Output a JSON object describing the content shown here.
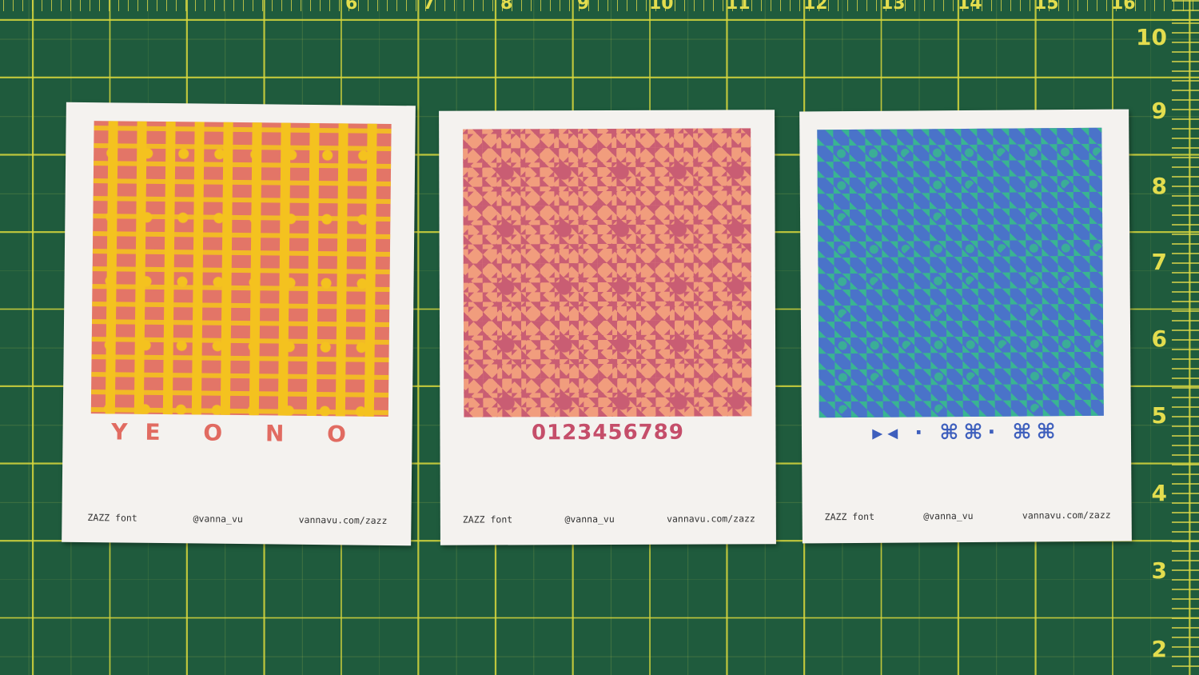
{
  "ruler": {
    "top_numbers": [
      "6",
      "7",
      "8",
      "9",
      "10",
      "11",
      "12",
      "13",
      "14",
      "15",
      "16"
    ],
    "side_numbers": [
      "10",
      "9",
      "8",
      "7",
      "6",
      "5",
      "4",
      "3",
      "2"
    ]
  },
  "cards": [
    {
      "glyphs": "YE O N O",
      "footer": {
        "name": "ZAZZ font",
        "handle": "@vanna_vu",
        "url": "vannavu.com/zazz"
      }
    },
    {
      "glyphs": "0123456789",
      "footer": {
        "name": "ZAZZ font",
        "handle": "@vanna_vu",
        "url": "vannavu.com/zazz"
      }
    },
    {
      "glyphs": "▸◂ · ⌘⌘· ⌘⌘",
      "footer": {
        "name": "ZAZZ font",
        "handle": "@vanna_vu",
        "url": "vannavu.com/zazz"
      }
    }
  ],
  "colors": {
    "mat": "#1f5b3d",
    "grid": "#d9d64a",
    "card": "#f4f2ef",
    "card1_bg": "#e37567",
    "card1_fg": "#f4c21f",
    "card2_bg": "#f19d7d",
    "card2_fg": "#c95d73",
    "card3_bg": "#4a73c9",
    "card3_fg": "#39b591"
  }
}
